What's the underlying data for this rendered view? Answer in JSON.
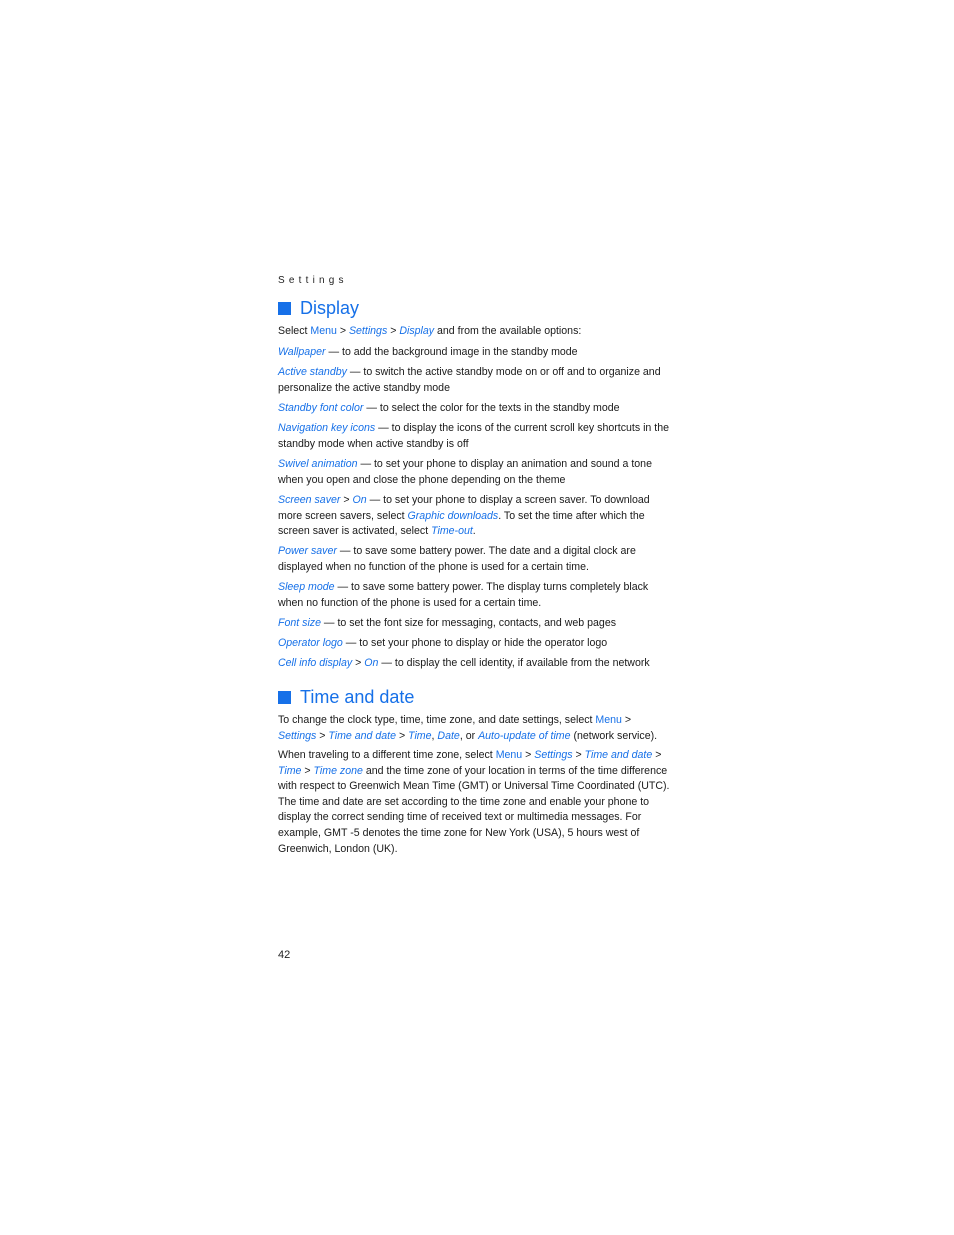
{
  "running_head": "Settings",
  "page_number": "42",
  "colors": {
    "accent": "#1670e8"
  },
  "display": {
    "heading": "Display",
    "intro": {
      "pre": "Select ",
      "menu": "Menu",
      "sep": " > ",
      "settings": "Settings",
      "display": "Display",
      "post": " and from the available options:"
    },
    "items": [
      {
        "link": "Wallpaper",
        "text": " — to add the background image in the standby mode"
      },
      {
        "link": "Active standby",
        "text": " — to switch the active standby mode on or off and to organize and personalize the active standby mode"
      },
      {
        "link": "Standby font color",
        "text": " — to select the color for the texts in the standby mode"
      },
      {
        "link": "Navigation key icons",
        "text": " — to display the icons of the current scroll key shortcuts in the standby mode when active standby is off"
      },
      {
        "link": "Swivel animation",
        "text": " — to set your phone to display an animation and sound a tone when you open and close the phone depending on the theme"
      },
      {
        "link": "Screen saver",
        "sep": " > ",
        "link2": "On",
        "text": " — to set your phone to display a screen saver. To download more screen savers, select ",
        "link3": "Graphic downloads",
        "text2": ". To set the time after which the screen saver is activated, select ",
        "link4": "Time-out",
        "text3": "."
      },
      {
        "link": "Power saver",
        "text": " — to save some battery power. The date and a digital clock are displayed when no function of the phone is used for a certain time."
      },
      {
        "link": "Sleep mode",
        "text": " — to save some battery power. The display turns completely black when no function of the phone is used for a certain time."
      },
      {
        "link": "Font size",
        "text": " — to set the font size for messaging, contacts, and web pages"
      },
      {
        "link": "Operator logo",
        "text": " — to set your phone to display or hide the operator logo"
      },
      {
        "link": "Cell info display",
        "sep": " > ",
        "link2": "On",
        "text": " — to display the cell identity, if available from the network"
      }
    ]
  },
  "time_date": {
    "heading": "Time and date",
    "p1": {
      "pre": "To change the clock type, time, time zone, and date settings, select ",
      "menu": "Menu",
      "sep": " > ",
      "settings": "Settings",
      "tad": "Time and date",
      "time": "Time",
      "comma": ", ",
      "date": "Date",
      "or": ", or ",
      "auto": "Auto-update of time",
      "post": " (network service)."
    },
    "p2": {
      "pre": "When traveling to a different time zone, select ",
      "menu": "Menu",
      "sep": " > ",
      "settings": "Settings",
      "tad": "Time and date",
      "time": "Time",
      "zone": "Time zone",
      "post": " and the time zone of your location in terms of the time difference with respect to Greenwich Mean Time (GMT) or Universal Time Coordinated (UTC). The time and date are set according to the time zone and enable your phone to display the correct sending time of received text or multimedia messages. For example, GMT -5 denotes the time zone for New York (USA), 5 hours west of Greenwich, London (UK)."
    }
  }
}
